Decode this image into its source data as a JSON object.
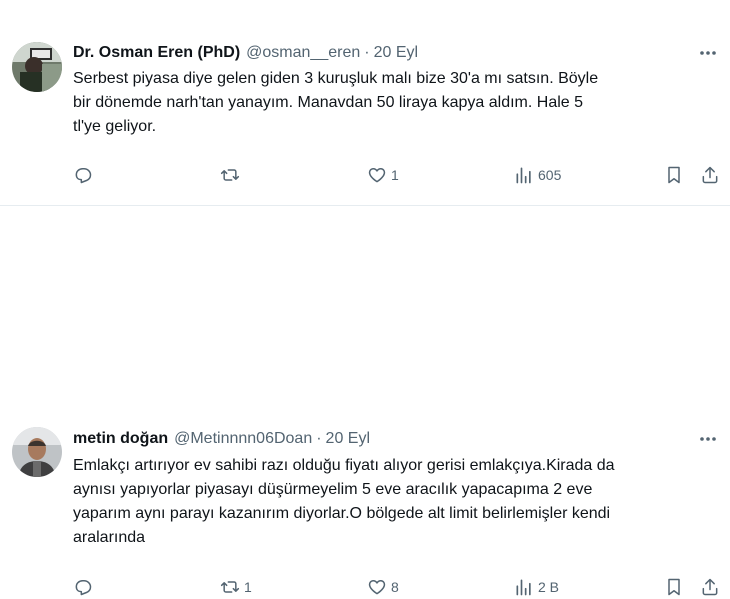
{
  "tweets": [
    {
      "name": "Dr. Osman Eren (PhD)",
      "handle": "@osman__eren",
      "dot": "·",
      "date": "20 Eyl",
      "text": "Serbest piyasa diye gelen giden 3 kuruşluk malı bize 30'a mı satsın. Böyle\nbir dönemde narh'tan yanayım. Manavdan 50 liraya kapya aldım. Hale 5\ntl'ye geliyor.",
      "reply_count": "",
      "retweet_count": "",
      "like_count": "1",
      "view_count": "605"
    },
    {
      "name": "metin doğan",
      "handle": "@Metinnnn06Doan",
      "dot": "·",
      "date": "20 Eyl",
      "text": "Emlakçı artırıyor ev sahibi razı olduğu fiyatı alıyor gerisi emlakçıya.Kirada da\naynısı yapıyorlar piyasayı düşürmeyelim 5 eve aracılık yapacapıma 2 eve\nyaparım aynı parayı kazanırım diyorlar.O bölgede alt limit belirlemişler kendi\naralarında",
      "reply_count": "",
      "retweet_count": "1",
      "like_count": "8",
      "view_count": "2 B"
    }
  ],
  "colors": {
    "text": "#0f1419",
    "secondary": "#536471",
    "divider": "#e6ecf0"
  },
  "icons": [
    "reply-icon",
    "retweet-icon",
    "like-icon",
    "views-icon",
    "bookmark-icon",
    "share-icon",
    "more-icon"
  ]
}
